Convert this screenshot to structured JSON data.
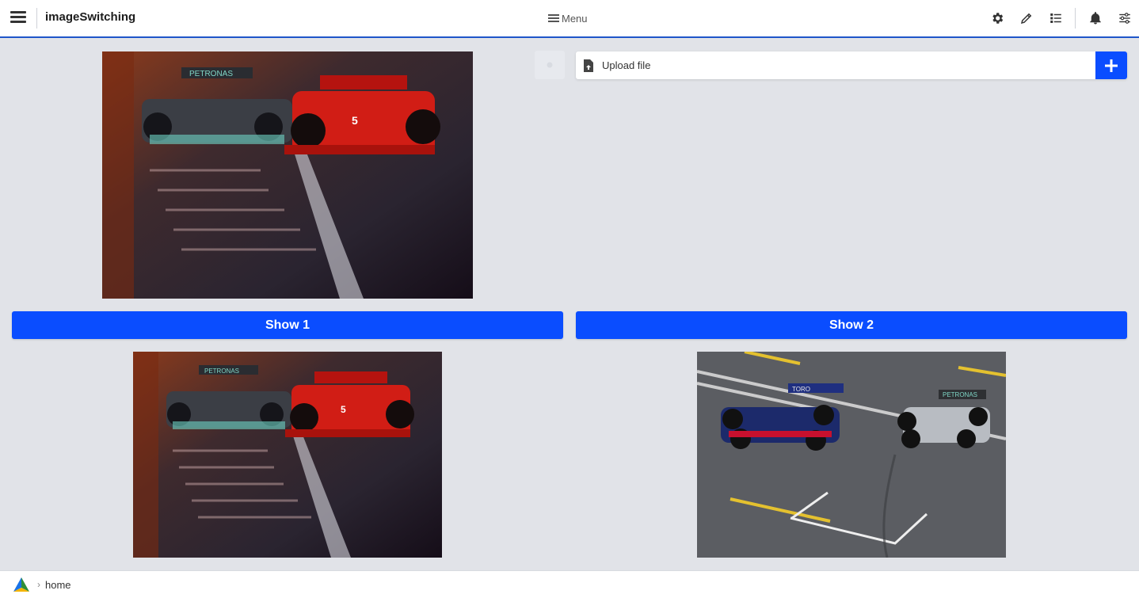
{
  "header": {
    "app_title": "imageSwitching",
    "menu_label": "Menu",
    "icons": [
      "menu-icon",
      "settings-icon",
      "edit-icon",
      "list-icon",
      "bell-icon",
      "sliders-icon"
    ]
  },
  "panel_right": {
    "upload_label": "Upload file",
    "add_icon": "plus-icon"
  },
  "buttons": {
    "show1_label": "Show 1",
    "show2_label": "Show 2"
  },
  "images": {
    "top_left": "ferrari-mercedes-photo",
    "bottom_left": "ferrari-mercedes-photo",
    "bottom_right": "tororosso-mercedes-photo"
  },
  "footer": {
    "breadcrumb": [
      "home"
    ]
  },
  "colors": {
    "accent": "#0a4dff",
    "header_border": "#1f56c9",
    "background": "#e1e3e8"
  }
}
